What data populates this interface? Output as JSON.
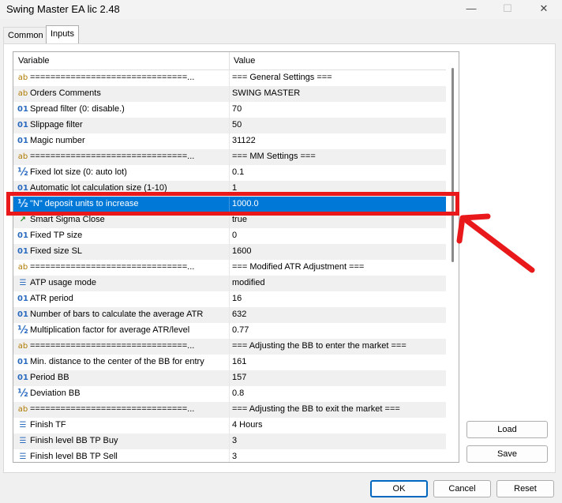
{
  "window": {
    "title": "Swing Master EA lic 2.48",
    "minimize": "—",
    "maximize": "☐",
    "close": "✕"
  },
  "tabs": [
    {
      "label": "Common",
      "active": false
    },
    {
      "label": "Inputs",
      "active": true
    }
  ],
  "grid": {
    "col_variable": "Variable",
    "col_value": "Value",
    "rows": [
      {
        "icon": "ab",
        "variable": "===============================...",
        "value": "=== General Settings ===",
        "selected": false
      },
      {
        "icon": "ab",
        "variable": "Orders Comments",
        "value": "SWING MASTER",
        "selected": false
      },
      {
        "icon": "01",
        "variable": "Spread filter (0: disable.)",
        "value": "70",
        "selected": false
      },
      {
        "icon": "01",
        "variable": "Slippage filter",
        "value": "50",
        "selected": false
      },
      {
        "icon": "01",
        "variable": "Magic number",
        "value": "31122",
        "selected": false
      },
      {
        "icon": "ab",
        "variable": "===============================...",
        "value": "=== MM Settings ===",
        "selected": false
      },
      {
        "icon": "½",
        "variable": "Fixed lot size (0: auto lot)",
        "value": "0.1",
        "selected": false
      },
      {
        "icon": "01",
        "variable": "Automatic lot calculation size (1-10)",
        "value": "1",
        "selected": false
      },
      {
        "icon": "½",
        "variable": "\"N\" deposit units to increase",
        "value": "1000.0",
        "selected": true
      },
      {
        "icon": "tf",
        "variable": "Smart Sigma Close",
        "value": "true",
        "selected": false
      },
      {
        "icon": "01",
        "variable": "Fixed TP size",
        "value": "0",
        "selected": false
      },
      {
        "icon": "01",
        "variable": "Fixed size SL",
        "value": "1600",
        "selected": false
      },
      {
        "icon": "ab",
        "variable": "===============================...",
        "value": "=== Modified ATR Adjustment ===",
        "selected": false
      },
      {
        "icon": "list",
        "variable": "ATP usage mode",
        "value": "modified",
        "selected": false
      },
      {
        "icon": "01",
        "variable": "ATR period",
        "value": "16",
        "selected": false
      },
      {
        "icon": "01",
        "variable": "Number of bars to calculate the average ATR",
        "value": "632",
        "selected": false
      },
      {
        "icon": "½",
        "variable": "Multiplication factor for average ATR/level",
        "value": "0.77",
        "selected": false
      },
      {
        "icon": "ab",
        "variable": "===============================...",
        "value": "=== Adjusting the BB to enter the market ===",
        "selected": false
      },
      {
        "icon": "01",
        "variable": "Min. distance to the center of the BB for entry",
        "value": "161",
        "selected": false
      },
      {
        "icon": "01",
        "variable": "Period BB",
        "value": "157",
        "selected": false
      },
      {
        "icon": "½",
        "variable": "Deviation BB",
        "value": "0.8",
        "selected": false
      },
      {
        "icon": "ab",
        "variable": "===============================...",
        "value": "=== Adjusting the BB to exit the market ===",
        "selected": false
      },
      {
        "icon": "list",
        "variable": "Finish TF",
        "value": "4 Hours",
        "selected": false
      },
      {
        "icon": "list",
        "variable": "Finish level BB TP Buy",
        "value": "3",
        "selected": false
      },
      {
        "icon": "list",
        "variable": "Finish level BB TP Sell",
        "value": "3",
        "selected": false
      }
    ]
  },
  "side_buttons": {
    "load": "Load",
    "save": "Save"
  },
  "footer_buttons": {
    "ok": "OK",
    "cancel": "Cancel",
    "reset": "Reset"
  },
  "colors": {
    "selection": "#0078d7",
    "annotation": "#e8181b"
  }
}
